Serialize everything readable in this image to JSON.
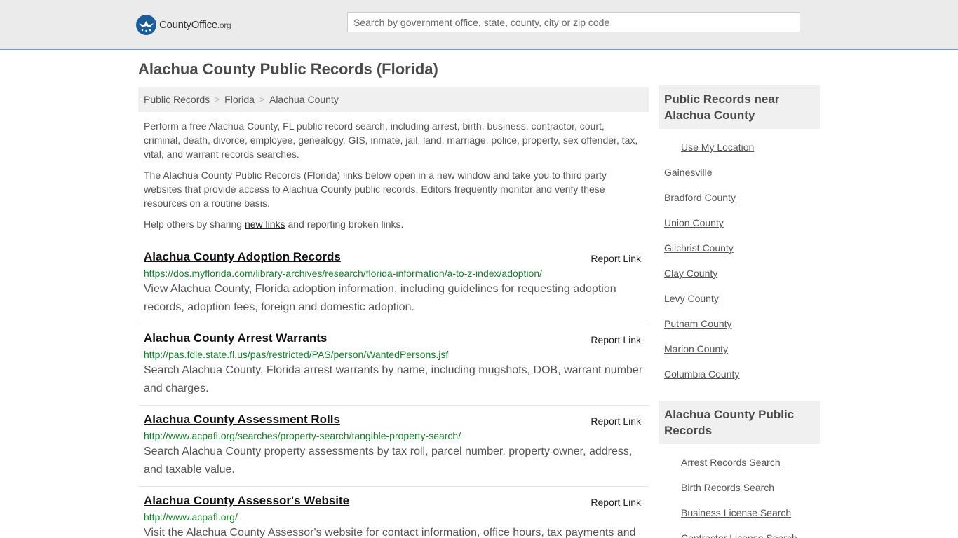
{
  "header": {
    "logo_main": "CountyOffice",
    "logo_org": ".org",
    "search_placeholder": "Search by government office, state, county, city or zip code"
  },
  "page_title": "Alachua County Public Records (Florida)",
  "breadcrumb": [
    "Public Records",
    "Florida",
    "Alachua County"
  ],
  "intro": {
    "p1": "Perform a free Alachua County, FL public record search, including arrest, birth, business, contractor, court, criminal, death, divorce, employee, genealogy, GIS, inmate, jail, land, marriage, police, property, sex offender, tax, vital, and warrant records searches.",
    "p2": "The Alachua County Public Records (Florida) links below open in a new window and take you to third party websites that provide access to Alachua County public records. Editors frequently monitor and verify these resources on a routine basis.",
    "p3_before": "Help others by sharing ",
    "p3_link": "new links",
    "p3_after": " and reporting broken links."
  },
  "report_label": "Report Link",
  "records": [
    {
      "title": "Alachua County Adoption Records",
      "url": "https://dos.myflorida.com/library-archives/research/florida-information/a-to-z-index/adoption/",
      "desc": "View Alachua County, Florida adoption information, including guidelines for requesting adoption records, adoption fees, foreign and domestic adoption."
    },
    {
      "title": "Alachua County Arrest Warrants",
      "url": "http://pas.fdle.state.fl.us/pas/restricted/PAS/person/WantedPersons.jsf",
      "desc": "Search Alachua County, Florida arrest warrants by name, including mugshots, DOB, warrant number and charges."
    },
    {
      "title": "Alachua County Assessment Rolls",
      "url": "http://www.acpafl.org/searches/property-search/tangible-property-search/",
      "desc": "Search Alachua County property assessments by tax roll, parcel number, property owner, address, and taxable value."
    },
    {
      "title": "Alachua County Assessor's Website",
      "url": "http://www.acpafl.org/",
      "desc": "Visit the Alachua County Assessor's website for contact information, office hours, tax payments and"
    }
  ],
  "sidebar": {
    "nearby_title": "Public Records near Alachua County",
    "use_location": "Use My Location",
    "nearby": [
      "Gainesville",
      "Bradford County",
      "Union County",
      "Gilchrist County",
      "Clay County",
      "Levy County",
      "Putnam County",
      "Marion County",
      "Columbia County"
    ],
    "county_title": "Alachua County Public Records",
    "county_links": [
      "Arrest Records Search",
      "Birth Records Search",
      "Business License Search",
      "Contractor License Search"
    ]
  }
}
